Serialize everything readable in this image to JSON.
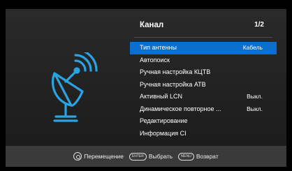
{
  "menu": {
    "title": "Канал",
    "page": "1/2",
    "items": [
      {
        "label": "Тип антенны",
        "value": "Кабель",
        "selected": true
      },
      {
        "label": "Автопоиск",
        "value": ""
      },
      {
        "label": "Ручная настройка КЦТВ",
        "value": ""
      },
      {
        "label": "Ручная настройка АТВ",
        "value": ""
      },
      {
        "label": "Активный LCN",
        "value": "Выкл."
      },
      {
        "label": "Динамическое повторное ...",
        "value": "Выкл."
      },
      {
        "label": "Редактирование",
        "value": ""
      },
      {
        "label": "Информация CI",
        "value": ""
      }
    ]
  },
  "footer": {
    "move_label": "Перемещение",
    "enter_key": "ENTER",
    "select_label": "Выбрать",
    "menu_key": "MENU",
    "back_label": "Возврат"
  },
  "colors": {
    "accent": "#0a6fcf",
    "icon": "#2aa3e0",
    "panel": "#222222",
    "footer": "#3a3a3a"
  },
  "icons": [
    "satellite-dish-icon",
    "nav-key-icon"
  ]
}
